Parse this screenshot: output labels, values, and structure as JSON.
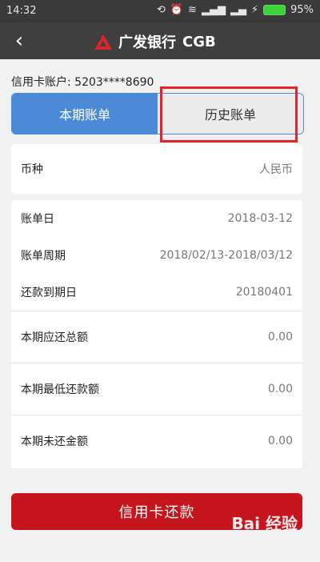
{
  "status": {
    "time": "14:32",
    "icons": [
      "sync-icon",
      "alarm-icon",
      "wifi-icon",
      "signal-icon",
      "signal-icon-2",
      "charging-icon"
    ],
    "battery": "95%"
  },
  "header": {
    "back_icon": "chevron-left-icon",
    "brand": "广发银行",
    "brand_en": "CGB"
  },
  "account": {
    "label": "信用卡账户:",
    "number": "5203****8690"
  },
  "tabs": [
    {
      "label": "本期账单"
    },
    {
      "label": "历史账单"
    }
  ],
  "currency": {
    "label": "币种",
    "value": "人民币"
  },
  "details": [
    {
      "label": "账单日",
      "value": "2018-03-12"
    },
    {
      "label": "账单周期",
      "value": "2018/02/13-2018/03/12"
    },
    {
      "label": "还款到期日",
      "value": "20180401"
    }
  ],
  "amounts": [
    {
      "label": "本期应还总额",
      "value": "0.00"
    },
    {
      "label": "本期最低还款额",
      "value": "0.00"
    },
    {
      "label": "本期未还金额",
      "value": "0.00"
    }
  ],
  "pay_button": "信用卡还款",
  "watermark": "Bai 经验"
}
